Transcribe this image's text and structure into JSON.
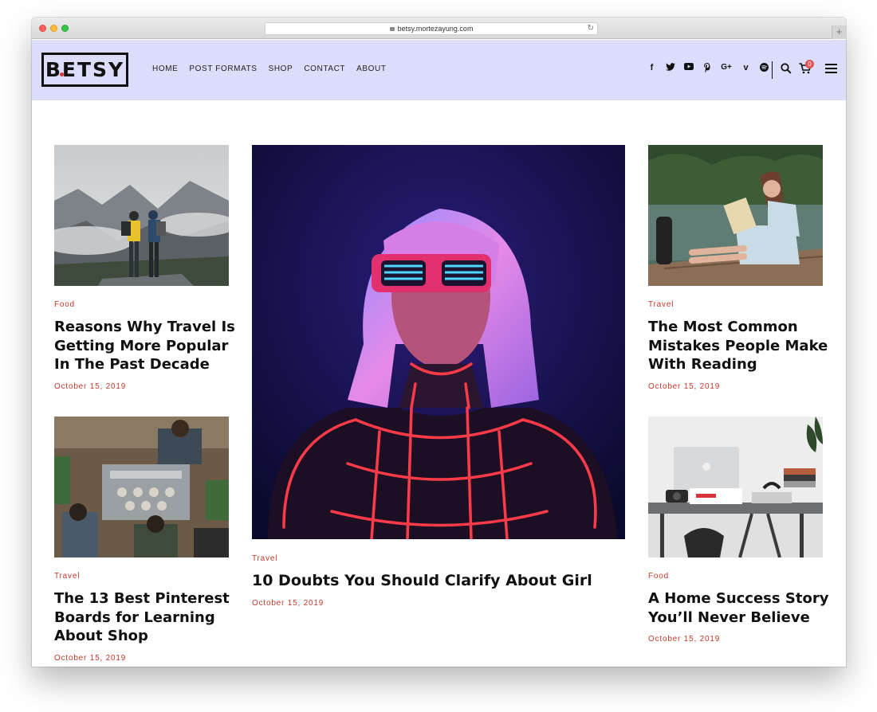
{
  "browser": {
    "url": "betsy.mortezayung.com"
  },
  "site": {
    "logo_text": "BETSY"
  },
  "nav": {
    "items": [
      "HOME",
      "POST FORMATS",
      "SHOP",
      "CONTACT",
      "ABOUT"
    ]
  },
  "social": {
    "icons": [
      "facebook-icon",
      "twitter-icon",
      "youtube-icon",
      "pinterest-icon",
      "google-plus-icon",
      "vimeo-icon",
      "spotify-icon"
    ]
  },
  "cart": {
    "count": "0"
  },
  "colors": {
    "header_bg": "#dcdcfb",
    "accent": "#c0392b",
    "text": "#111111"
  },
  "posts": [
    {
      "category": "Food",
      "title_lines": [
        "Reasons Why Travel Is",
        "Getting More Popular",
        "In The Past Decade"
      ],
      "date": "October 15, 2019",
      "image": "hikers-mountain-image"
    },
    {
      "category": "Travel",
      "title_lines": [
        "The 13 Best Pinterest",
        "Boards for Learning",
        "About Shop"
      ],
      "date": "October 15, 2019",
      "image": "cafe-barista-image"
    },
    {
      "category": "Travel",
      "title_lines": [
        "10 Doubts You Should Clarify About Girl"
      ],
      "date": "October 15, 2019",
      "image": "neon-girl-image"
    },
    {
      "category": "Travel",
      "title_lines": [
        "The Most Common",
        "Mistakes People Make",
        "With Reading"
      ],
      "date": "October 15, 2019",
      "image": "woman-reading-lake-image"
    },
    {
      "category": "Food",
      "title_lines": [
        "A Home Success Story",
        "You’ll Never Believe"
      ],
      "date": "October 15, 2019",
      "image": "desk-laptop-image"
    }
  ]
}
